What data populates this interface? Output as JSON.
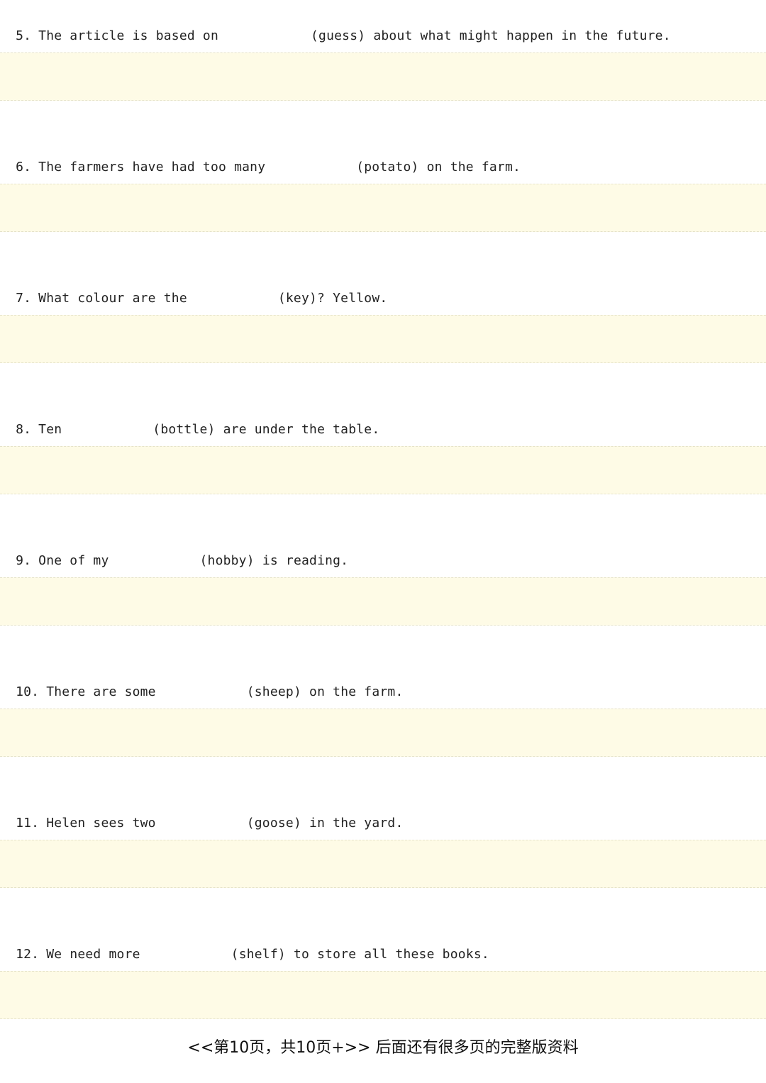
{
  "questions": [
    {
      "number": "5.",
      "before": "The article is based on",
      "word": "(guess)",
      "after": "about what might happen in the future."
    },
    {
      "number": "6.",
      "before": "The farmers have had too many",
      "word": "(potato)",
      "after": "on the farm."
    },
    {
      "number": "7.",
      "before": "What colour are the",
      "word": "(key)?",
      "after": "Yellow."
    },
    {
      "number": "8.",
      "before": "Ten",
      "word": "(bottle)",
      "after": "are under the table."
    },
    {
      "number": "9.",
      "before": "One of my",
      "word": "(hobby)",
      "after": "is reading."
    },
    {
      "number": "10.",
      "before": "There are some",
      "word": "(sheep)",
      "after": "on the farm."
    },
    {
      "number": "11.",
      "before": "Helen sees two",
      "word": "(goose)",
      "after": "in the yard."
    },
    {
      "number": "12.",
      "before": "We need more",
      "word": "(shelf)",
      "after": "to store all these books."
    }
  ],
  "footer": {
    "text": "<<第10页，共10页+>> 后面还有很多页的完整版资料"
  }
}
